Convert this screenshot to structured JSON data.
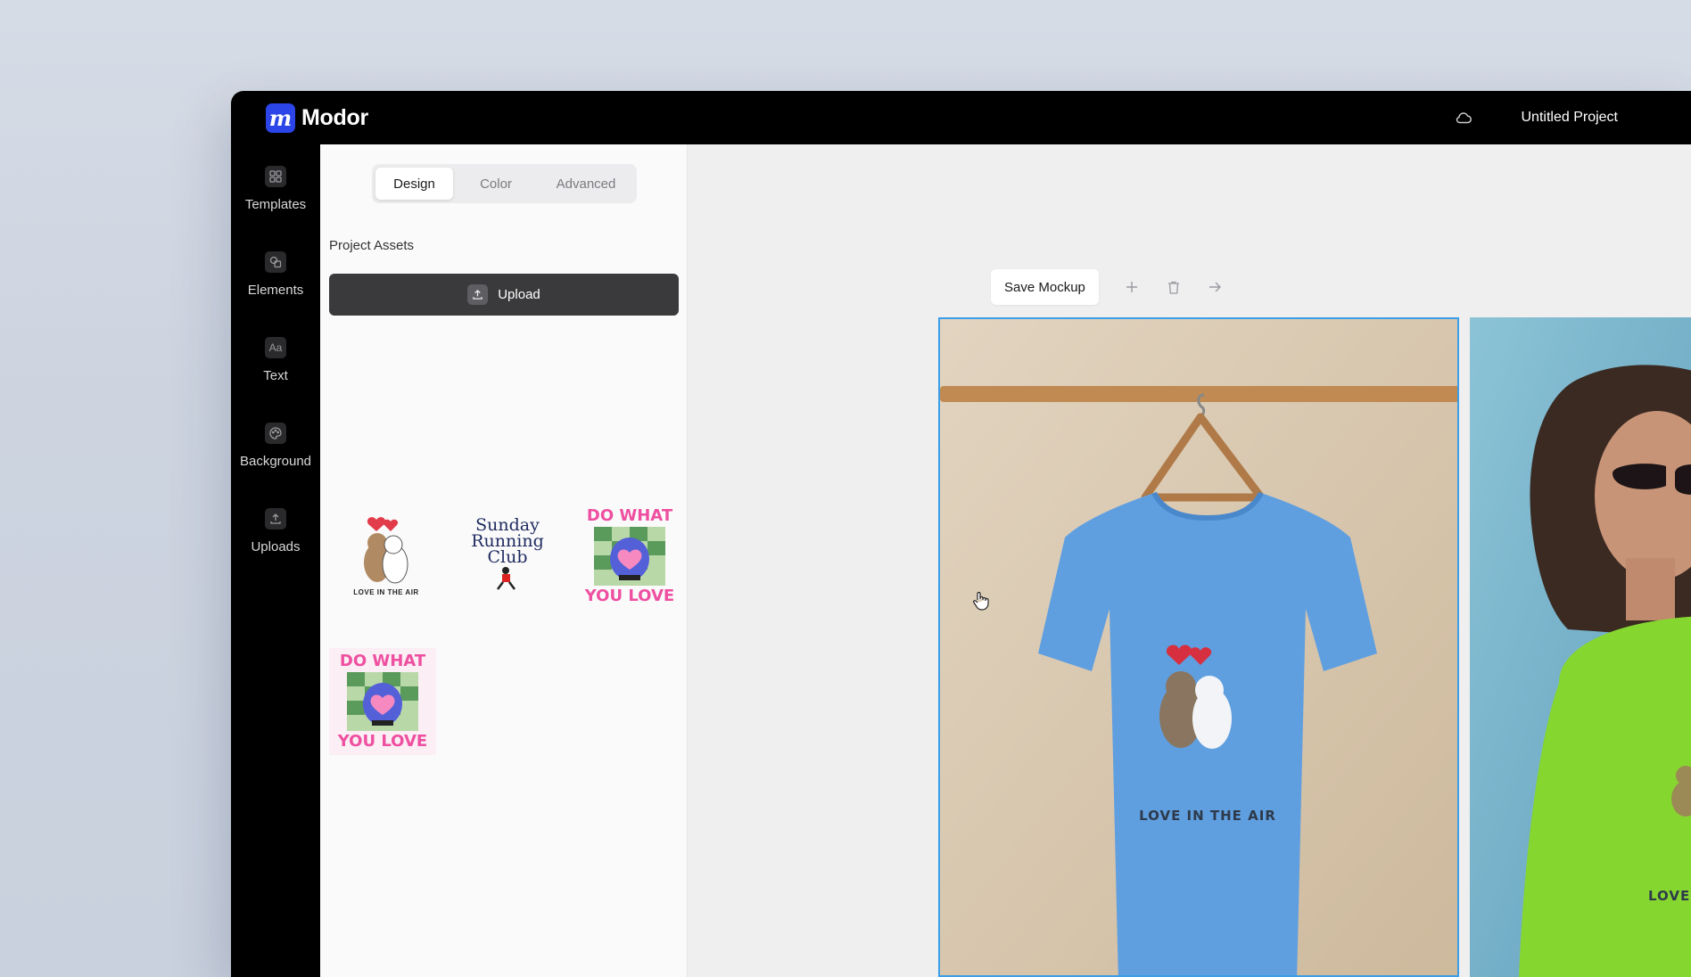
{
  "app": {
    "logo_letter": "m",
    "name": "Modor",
    "project_title": "Untitled Project"
  },
  "sidebar": {
    "items": [
      {
        "label": "Templates",
        "icon": "grid-icon"
      },
      {
        "label": "Elements",
        "icon": "shapes-icon"
      },
      {
        "label": "Text",
        "icon": "text-icon",
        "glyph": "Aa"
      },
      {
        "label": "Background",
        "icon": "palette-icon"
      },
      {
        "label": "Uploads",
        "icon": "upload-icon"
      }
    ]
  },
  "panel": {
    "tabs": [
      {
        "label": "Design",
        "active": true
      },
      {
        "label": "Color",
        "active": false
      },
      {
        "label": "Advanced",
        "active": false
      }
    ],
    "section_title": "Project Assets",
    "upload_label": "Upload",
    "assets": [
      {
        "name": "love-in-the-air-design",
        "caption": "LOVE IN THE AIR"
      },
      {
        "name": "sunday-running-club-design",
        "lines": [
          "Sunday",
          "Running",
          "Club"
        ]
      },
      {
        "name": "do-what-you-love-design",
        "lines": [
          "DO WHAT",
          "YOU LOVE"
        ]
      },
      {
        "name": "do-what-you-love-design-2",
        "lines": [
          "DO WHAT",
          "YOU LOVE"
        ]
      }
    ]
  },
  "canvas": {
    "save_mockup_label": "Save Mockup",
    "mockups": [
      {
        "name": "blue-tshirt-on-hanger",
        "shirt_color": "#5f9fe0",
        "print": "LOVE IN THE AIR",
        "selected": true
      },
      {
        "name": "green-tshirt-on-model",
        "shirt_color": "#86d630",
        "print": "LOVE IN THE AIR",
        "selected": false
      }
    ]
  },
  "colors": {
    "accent": "#2b45e8",
    "selection": "#3a9ee8",
    "topbar": "#000000"
  }
}
